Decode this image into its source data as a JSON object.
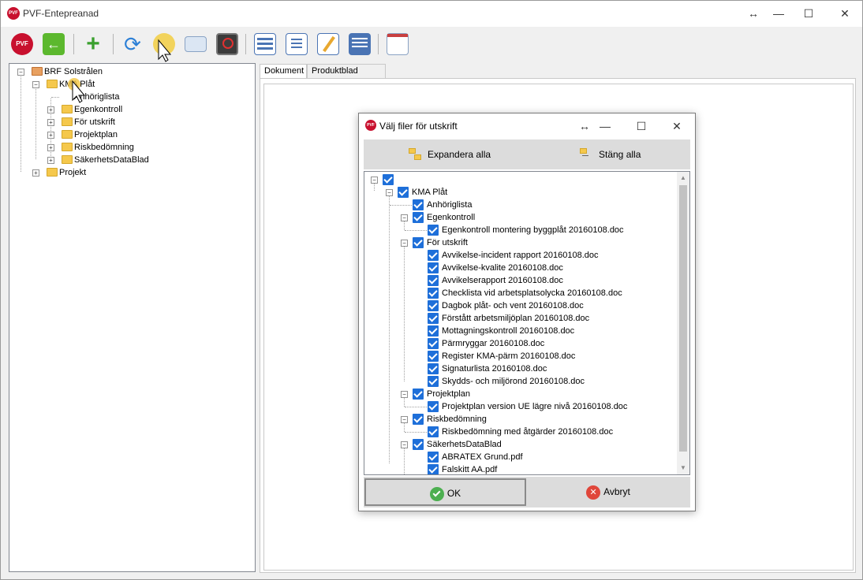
{
  "window": {
    "title": "PVF-Entepreanad",
    "app_icon_text": "PVF",
    "controls": {
      "resize": "↔",
      "minimize": "—",
      "maximize": "☐",
      "close": "✕"
    }
  },
  "toolbar": {
    "buttons": [
      {
        "name": "pvf-app-icon",
        "tooltip": ""
      },
      {
        "name": "back-arrow-icon",
        "tooltip": ""
      },
      {
        "name": "add-icon",
        "tooltip": ""
      },
      {
        "name": "refresh-icon",
        "tooltip": ""
      },
      {
        "name": "print-select-icon",
        "tooltip": ""
      },
      {
        "name": "email-icon",
        "tooltip": ""
      },
      {
        "name": "monitor-block-icon",
        "tooltip": ""
      },
      {
        "name": "list-view-icon",
        "tooltip": ""
      },
      {
        "name": "checklist-icon",
        "tooltip": ""
      },
      {
        "name": "edit-document-icon",
        "tooltip": ""
      },
      {
        "name": "clipboard-icon",
        "tooltip": ""
      },
      {
        "name": "window-layout-icon",
        "tooltip": ""
      }
    ]
  },
  "tree": {
    "root": "BRF Solstrålen",
    "kma": "KMA Plåt",
    "items": [
      "Anhöriglista",
      "Egenkontroll",
      "För utskrift",
      "Projektplan",
      "Riskbedömning",
      "SäkerhetsDataBlad"
    ],
    "projekt": "Projekt"
  },
  "tabs": [
    "Dokument",
    "Produktblad direkt"
  ],
  "dialog": {
    "title": "Välj filer för utskrift",
    "icon_text": "PVF",
    "controls": {
      "resize": "↔",
      "minimize": "—",
      "maximize": "☐",
      "close": "✕"
    },
    "expand_all": "Expandera alla",
    "close_all": "Stäng alla",
    "tree": {
      "kma": "KMA Plåt",
      "anhoriglista": "Anhöriglista",
      "egenkontroll": "Egenkontroll",
      "egenkontroll_file": "Egenkontroll montering byggplåt 20160108.doc",
      "for_utskrift": "För utskrift",
      "for_utskrift_files": [
        "Avvikelse-incident rapport 20160108.doc",
        "Avvikelse-kvalite 20160108.doc",
        "Avvikelserapport 20160108.doc",
        "Checklista vid arbetsplatsolycka 20160108.doc",
        "Dagbok plåt- och vent 20160108.doc",
        "Förstått arbetsmiljöplan 20160108.doc",
        "Mottagningskontroll 20160108.doc",
        "Pärmryggar 20160108.doc",
        "Register KMA-pärm 20160108.doc",
        "Signaturlista 20160108.doc",
        "Skydds- och miljörond 20160108.doc"
      ],
      "projektplan": "Projektplan",
      "projektplan_file": "Projektplan version UE lägre nivå 20160108.doc",
      "riskbedomning": "Riskbedömning",
      "riskbedomning_file": "Riskbedömning med åtgärder 20160108.doc",
      "sakerhetsdatablad": "SäkerhetsDataBlad",
      "sakerhetsdatablad_files": [
        "ABRATEX Grund.pdf",
        "Falskitt AA.pdf"
      ]
    },
    "ok": "OK",
    "cancel": "Avbryt"
  },
  "colors": {
    "checkbox": "#1e6fd9",
    "folder": "#f5c84c",
    "brand_red": "#c8102e",
    "ok_green": "#4caf50",
    "cancel_red": "#e0463a"
  }
}
